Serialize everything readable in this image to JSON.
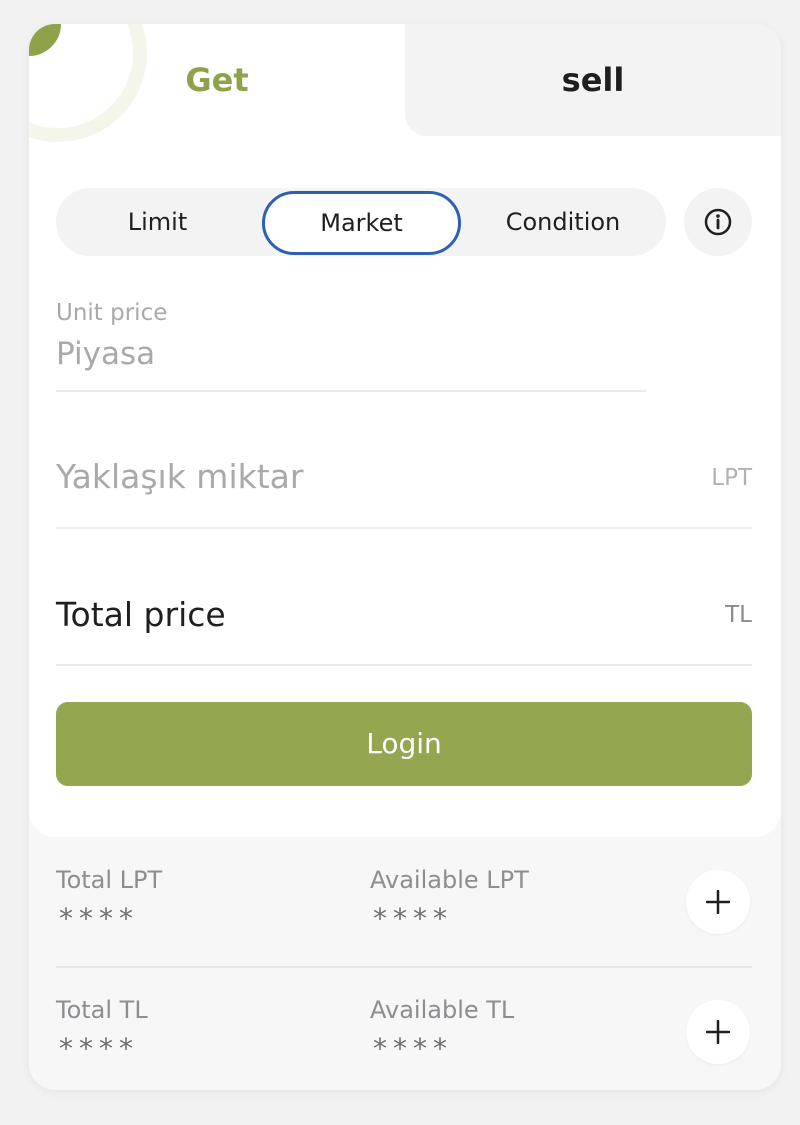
{
  "tabs": {
    "get_label": "Get",
    "sell_label": "sell"
  },
  "order_types": {
    "limit": "Limit",
    "market": "Market",
    "condition": "Condition",
    "selected": "Market"
  },
  "unit_price": {
    "label": "Unit price",
    "value": "Piyasa"
  },
  "amount": {
    "placeholder": "Yaklaşık miktar",
    "unit": "LPT"
  },
  "total": {
    "label": "Total price",
    "unit": "TL"
  },
  "login_button": "Login",
  "balances": {
    "lpt": {
      "total_label": "Total LPT",
      "total_value": "****",
      "available_label": "Available LPT",
      "available_value": "****"
    },
    "tl": {
      "total_label": "Total TL",
      "total_value": "****",
      "available_label": "Available TL",
      "available_value": "****"
    }
  },
  "icons": {
    "info": "info-icon",
    "plus": "plus-icon"
  },
  "colors": {
    "accent": "#92a74f",
    "selected_border": "#2f5fb3"
  }
}
